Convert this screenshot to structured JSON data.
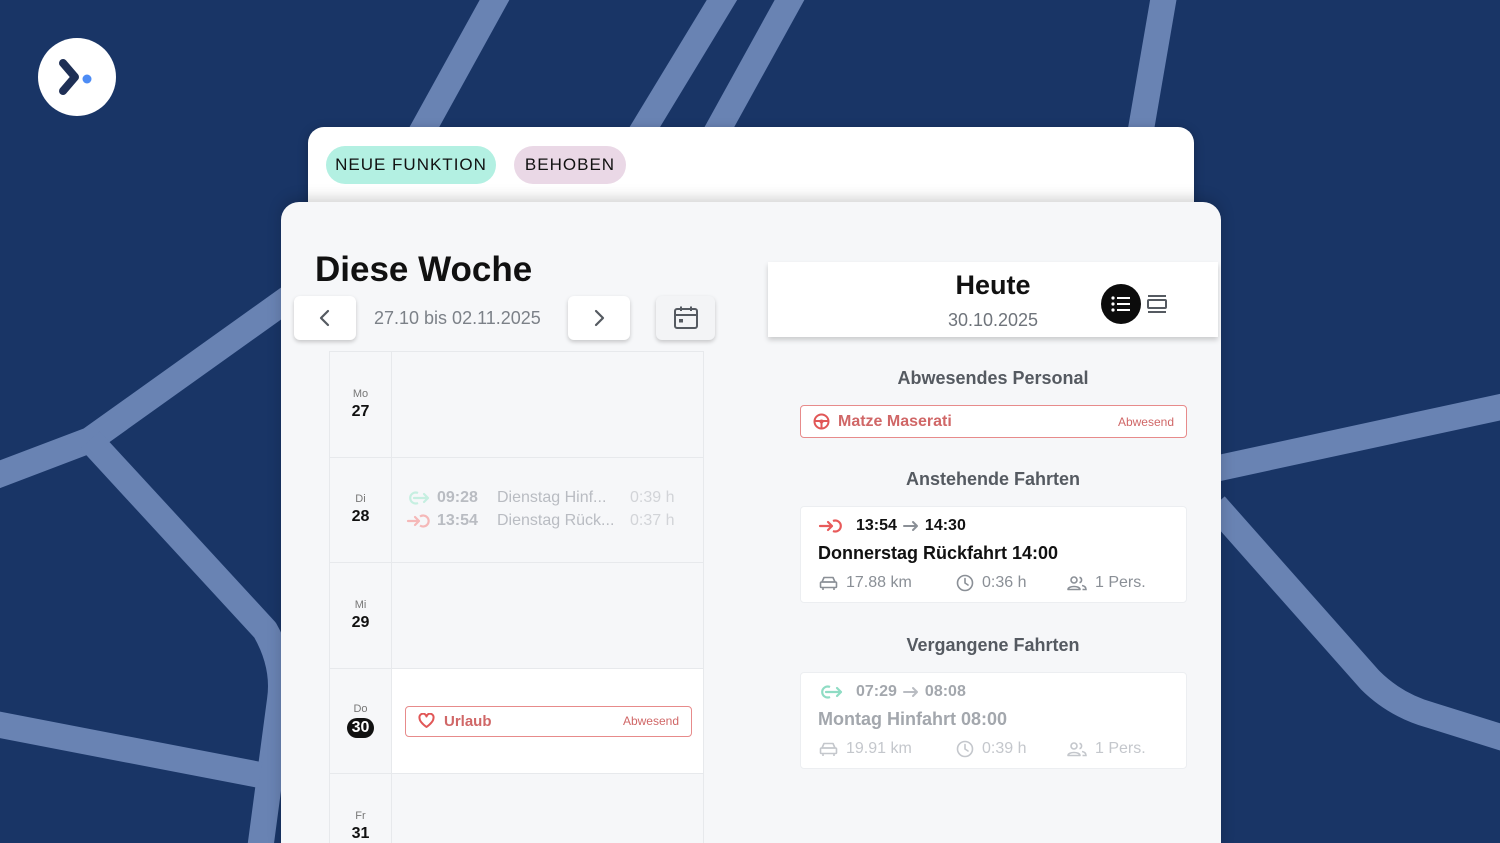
{
  "badges": {
    "new_feature": "NEUE FUNKTION",
    "fixed": "BEHOBEN"
  },
  "week": {
    "title": "Diese Woche",
    "range": "27.10 bis 02.11.2025",
    "days": [
      {
        "name": "Mo",
        "num": "27"
      },
      {
        "name": "Di",
        "num": "28",
        "trips": [
          {
            "time": "09:28",
            "name": "Dienstag Hinf...",
            "duration": "0:39 h"
          },
          {
            "time": "13:54",
            "name": "Dienstag Rück...",
            "duration": "0:37 h"
          }
        ]
      },
      {
        "name": "Mi",
        "num": "29"
      },
      {
        "name": "Do",
        "num": "30",
        "absence": {
          "label": "Urlaub",
          "status": "Abwesend"
        }
      },
      {
        "name": "Fr",
        "num": "31"
      }
    ]
  },
  "today": {
    "title": "Heute",
    "date": "30.10.2025",
    "absent_title": "Abwesendes Personal",
    "absent_person": {
      "name": "Matze Maserati",
      "status": "Abwesend"
    },
    "upcoming_title": "Anstehende Fahrten",
    "upcoming": {
      "start": "13:54",
      "end": "14:30",
      "title": "Donnerstag Rückfahrt 14:00",
      "distance": "17.88 km",
      "duration": "0:36 h",
      "persons": "1 Pers."
    },
    "past_title": "Vergangene Fahrten",
    "past": {
      "start": "07:29",
      "end": "08:08",
      "title": "Montag Hinfahrt 08:00",
      "distance": "19.91 km",
      "duration": "0:39 h",
      "persons": "1 Pers."
    }
  },
  "colors": {
    "background": "#193566",
    "roads": "#6983b3",
    "outbound": "#8fdcc4",
    "return": "#e85a5a",
    "absence": "#d06767",
    "new_feature_badge": "#b3f0e2",
    "fixed_badge": "#ead8e6"
  },
  "icons": {
    "logo": "chevron-dot-logo",
    "prev": "chevron-left-icon",
    "next": "chevron-right-icon",
    "calendar": "calendar-icon",
    "outbound": "arrow-into-circle-icon",
    "return": "arrow-out-circle-icon",
    "heart": "heart-icon",
    "steering": "steering-wheel-icon",
    "car": "car-icon",
    "clock": "clock-icon",
    "people": "people-icon",
    "list_view": "list-icon",
    "card_view": "card-view-icon"
  }
}
